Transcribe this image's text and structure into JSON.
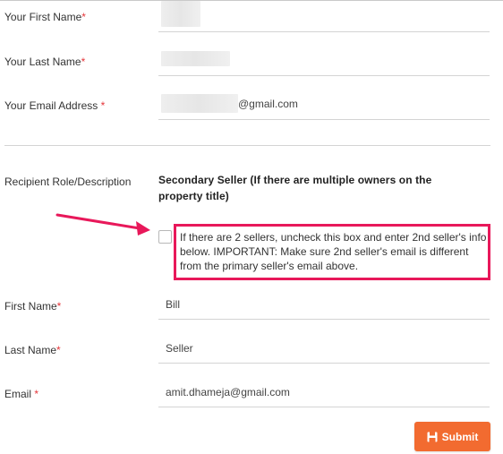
{
  "seller": {
    "first_name_label": "Your First Name",
    "last_name_label": "Your Last Name",
    "email_label": "Your Email Address",
    "email_suffix": "@gmail.com"
  },
  "recipient": {
    "role_label": "Recipient Role/Description",
    "role_value": "Secondary Seller (If there are multiple owners on the property title)",
    "checkbox_note": "If there are 2 sellers, uncheck this box and enter 2nd seller's info below. IMPORTANT: Make sure 2nd seller's email is different from the primary seller's email above.",
    "first_name_label": "First Name",
    "first_name_value": "Bill",
    "last_name_label": "Last Name",
    "last_name_value": "Seller",
    "email_label": "Email",
    "email_value": "amit.dhameja@gmail.com"
  },
  "required_marker": "*",
  "submit_label": "Submit",
  "colors": {
    "highlight_border": "#e8185a",
    "submit_bg": "#f26b30",
    "required": "#e5353a"
  },
  "icons": {
    "arrow": "arrow-pointing-right-icon",
    "submit": "save-icon"
  }
}
